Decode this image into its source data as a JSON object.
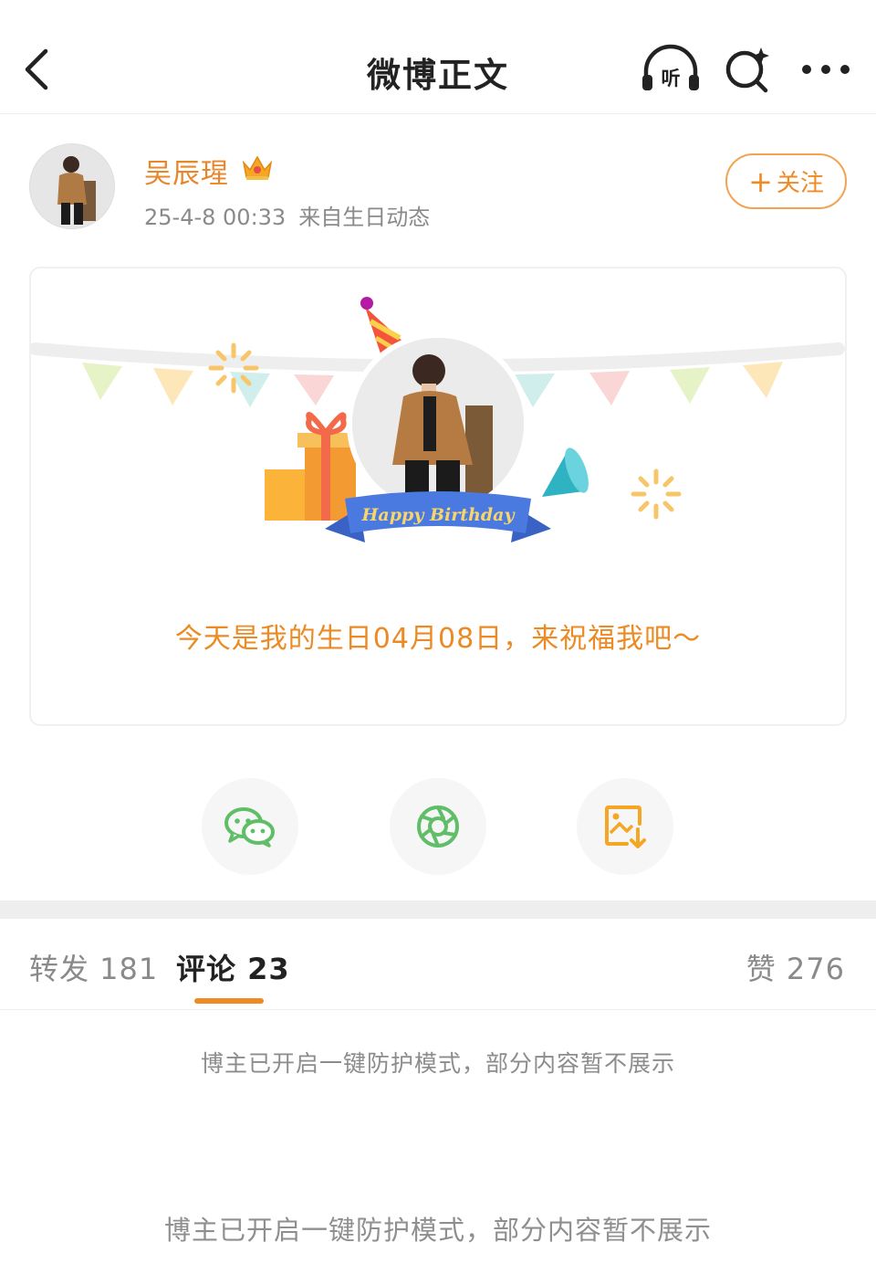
{
  "header": {
    "title": "微博正文",
    "listen_label": "听",
    "icons": [
      "back-icon",
      "listen-headphone-icon",
      "ai-search-icon",
      "more-icon"
    ]
  },
  "author": {
    "name": "吴辰瑆",
    "time": "25-4-8 00:33",
    "source": "来自生日动态",
    "follow_label": "关注",
    "follow_plus": "+"
  },
  "card": {
    "banner_text": "Happy Birthday",
    "message": "今天是我的生日04月08日，来祝福我吧～"
  },
  "share": {
    "icons": [
      "wechat-icon",
      "moments-icon",
      "save-image-icon"
    ]
  },
  "tabs": {
    "repost": "转发 181",
    "comments": "评论 23",
    "likes": "赞 276"
  },
  "notices": {
    "first": "博主已开启一键防护模式，部分内容暂不展示",
    "second": "博主已开启一键防护模式，部分内容暂不展示"
  },
  "colors": {
    "accent": "#f08a24",
    "name": "#e8862a",
    "wechat_green": "#5fbe67",
    "save_orange": "#f5a623",
    "banner_blue": "#3f6fd6"
  }
}
